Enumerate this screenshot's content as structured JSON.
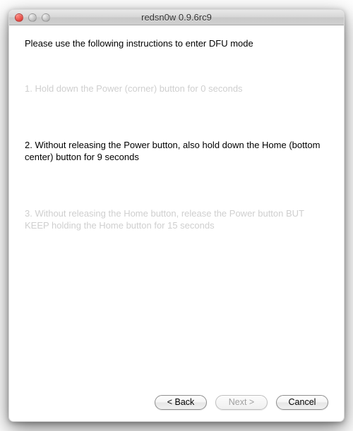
{
  "window": {
    "title": "redsn0w 0.9.6rc9"
  },
  "content": {
    "intro": "Please use the following instructions to enter DFU mode",
    "step1": "1. Hold down the Power (corner) button for 0 seconds",
    "step2": "2. Without releasing the Power button, also hold down the Home (bottom center) button for 9 seconds",
    "step3": "3. Without releasing the Home button, release the Power button BUT KEEP holding the Home button for 15 seconds"
  },
  "buttons": {
    "back": "< Back",
    "next": "Next >",
    "cancel": "Cancel"
  }
}
